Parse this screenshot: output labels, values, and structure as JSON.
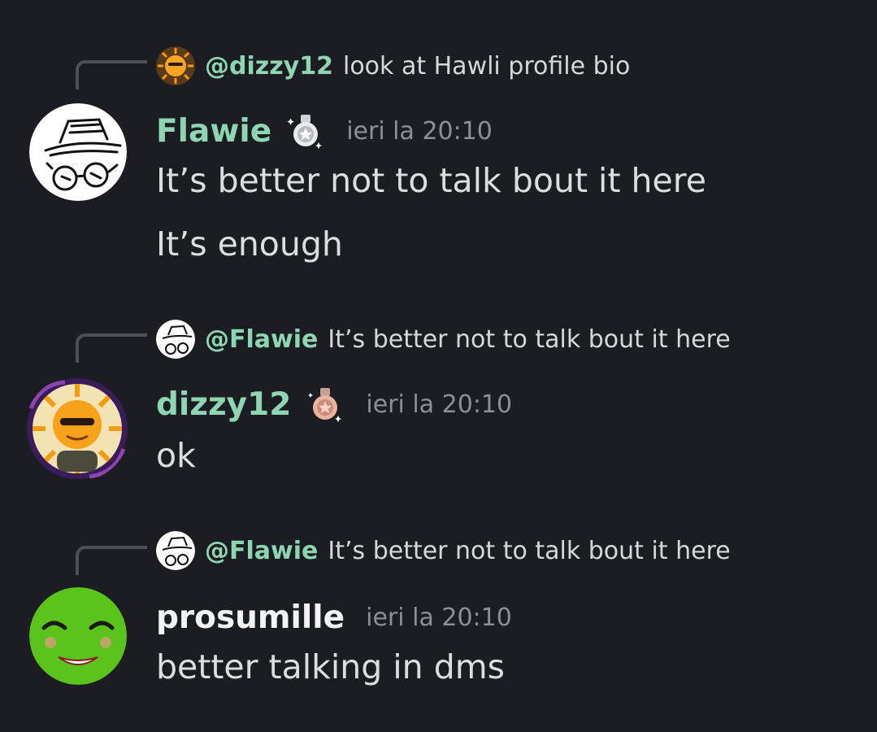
{
  "colors": {
    "background": "#1c1d22",
    "mention": "#8ed6b3",
    "username_green": "#8ed6b3",
    "username_white": "#f2f3f5",
    "timestamp": "#8d8f98",
    "reply_line": "#4e5058"
  },
  "messages": [
    {
      "reply": {
        "mention": "@dizzy12",
        "text": "look at Hawli profile bio",
        "avatar_icon": "sun-avatar-icon"
      },
      "author": {
        "name": "Flawie",
        "avatar_icon": "sketch-avatar-icon",
        "badge_icon": "silver-medal-icon"
      },
      "time": "ieri la 20:10",
      "lines": [
        "It’s better not to talk bout it here",
        "It’s enough"
      ]
    },
    {
      "reply": {
        "mention": "@Flawie",
        "text": "It’s better not to talk bout it here",
        "avatar_icon": "sketch-avatar-icon"
      },
      "author": {
        "name": "dizzy12",
        "avatar_icon": "sun-avatar-icon",
        "badge_icon": "bronze-medal-icon"
      },
      "time": "ieri la 20:10",
      "lines": [
        "ok"
      ]
    },
    {
      "reply": {
        "mention": "@Flawie",
        "text": "It’s better not to talk bout it here",
        "avatar_icon": "sketch-avatar-icon"
      },
      "author": {
        "name": "prosumille",
        "avatar_icon": "green-smiley-avatar-icon"
      },
      "time": "ieri la 20:10",
      "lines": [
        "better talking in dms"
      ]
    }
  ]
}
